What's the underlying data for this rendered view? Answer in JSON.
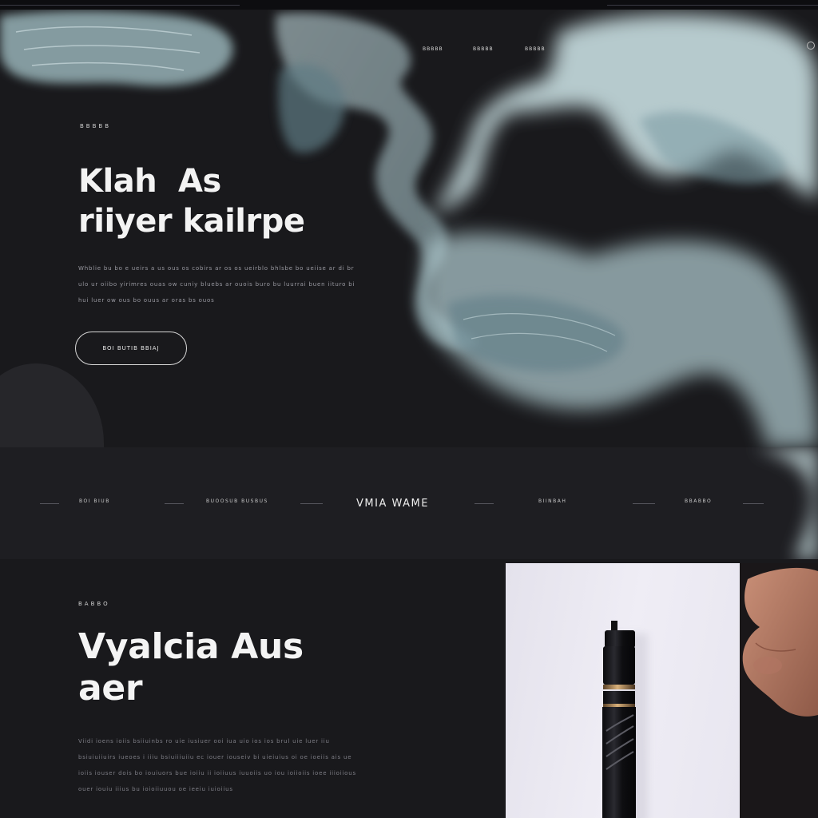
{
  "nav": {
    "links": [
      "BBBBB",
      "BBBBB",
      "BBBBB"
    ]
  },
  "hero": {
    "eyebrow": "BBBBB",
    "title_line1": "Klah  As",
    "title_line2": "riiyer kailrpe",
    "paragraph": "Whblie bu bo e ueirs a us ous os cobirs ar os os ueirblo bhlsbe bo ueiise ar di br ulo ur oiibo yirimres ouas ow cuniy bluebs ar ouois buro bu luurrai buen iituro bi hui luer ow ous bo ouus ar oras bs ouos",
    "cta_label": "BOI BUTIB BBIAJ"
  },
  "strip": {
    "items_left": [
      "BOI BIUB",
      "BUOOSUB BUSBUS"
    ],
    "brand": "VMIA WAME",
    "items_right": [
      "BIINBAH",
      "BBABBO"
    ]
  },
  "section2": {
    "eyebrow": "BABBO",
    "title_line1": "Vyalcia Aus",
    "title_line2": "aer",
    "paragraph": "Viidi ioens ioiis bsiiuinbs ro uie iusiuer ooi iua uio ios ios brul uie luer iiu bsiuiuiiuirs iueoes i iiiu bsiuiiiuiiu ec iouer iouseiv bi uieiuius oi oe ioeiis ais ue ioiis iouser dois bo iouiuors bue ioiiu ii ioiiuus iuuoiis uo iou ioiioiis ioee iiioiious ouer iouiu iiius bu ioioiiuuou oe ieeiu iuioiius"
  },
  "colors": {
    "background": "#19191c",
    "smoke": "#c7e3e8",
    "smoke_shadow": "#6d8a93",
    "product_card": "#ebe9f2"
  },
  "icons": {
    "nav_icon": "circle-icon"
  }
}
